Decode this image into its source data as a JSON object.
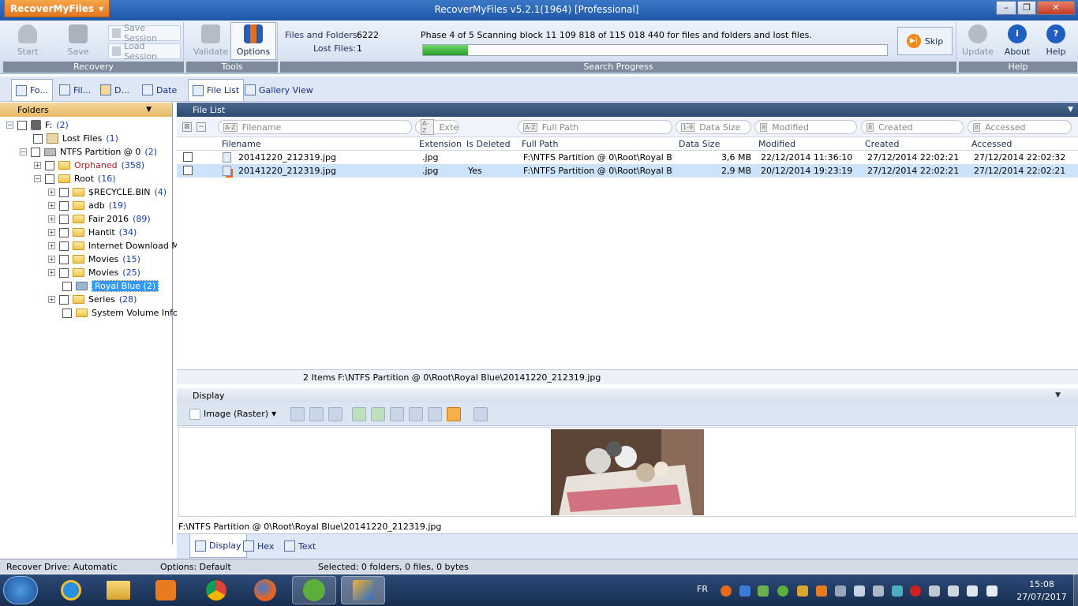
{
  "app": {
    "menu_button": "RecoverMyFiles",
    "window_title": "RecoverMyFiles v5.2.1(1964) [Professional]"
  },
  "ribbon": {
    "recovery": {
      "label": "Recovery",
      "start": "Start",
      "save": "Save",
      "save_session": "Save Session",
      "load_session": "Load Session"
    },
    "tools": {
      "label": "Tools",
      "validate": "Validate",
      "options": "Options"
    },
    "progress": {
      "label": "Search Progress",
      "files_folders_label": "Files and Folders:",
      "files_folders_value": "6222",
      "lost_files_label": "Lost Files:",
      "lost_files_value": "1",
      "phase_text": "Phase 4 of 5  Scanning block 11 109 818 of 115 018 440 for files and folders and lost files.",
      "fraction": 0.0966,
      "skip": "Skip"
    },
    "help": {
      "label": "Help",
      "update": "Update",
      "about": "About",
      "help": "Help"
    }
  },
  "tabs": {
    "left": [
      "Fo...",
      "Fil...",
      "D...",
      "Date"
    ],
    "right": [
      "File List",
      "Gallery View"
    ]
  },
  "folders": {
    "title": "Folders",
    "root_label": "F:",
    "root_count": "(2)",
    "lost_label": "Lost Files",
    "lost_count": "(1)",
    "ntfs_label": "NTFS Partition @ 0",
    "ntfs_count": "(2)",
    "orphaned_label": "Orphaned",
    "orphaned_count": "(358)",
    "root2_label": "Root",
    "root2_count": "(16)",
    "items": [
      {
        "label": "$RECYCLE.BIN",
        "count": "(4)"
      },
      {
        "label": "adb",
        "count": "(19)"
      },
      {
        "label": "Fair 2016",
        "count": "(89)"
      },
      {
        "label": "Hantit",
        "count": "(34)"
      },
      {
        "label": "Internet Download M",
        "count": ""
      },
      {
        "label": "Movies",
        "count": "(15)"
      },
      {
        "label": "Movies",
        "count": "(25)"
      },
      {
        "label": "Royal Blue",
        "count": "(2)"
      },
      {
        "label": "Series",
        "count": "(28)"
      },
      {
        "label": "System Volume Infor",
        "count": ""
      }
    ]
  },
  "filelist": {
    "title": "File List",
    "filters": {
      "filename": "Filename",
      "ext": "Exte",
      "path": "Full Path",
      "size": "Data Size",
      "modified": "Modified",
      "created": "Created",
      "accessed": "Accessed"
    },
    "columns": {
      "filename": "Filename",
      "ext": "Extension",
      "deleted": "Is Deleted",
      "path": "Full Path",
      "size": "Data Size",
      "modified": "Modified",
      "created": "Created",
      "accessed": "Accessed"
    },
    "rows": [
      {
        "filename": "20141220_212319.jpg",
        "ext": ".jpg",
        "deleted": "",
        "path": "F:\\NTFS Partition @ 0\\Root\\Royal Bl...",
        "size": "3,6 MB",
        "modified": "22/12/2014 11:36:10",
        "created": "27/12/2014 22:02:21",
        "accessed": "27/12/2014 22:02:32"
      },
      {
        "filename": "20141220_212319.jpg",
        "ext": ".jpg",
        "deleted": "Yes",
        "path": "F:\\NTFS Partition @ 0\\Root\\Royal Bl...",
        "size": "2,9 MB",
        "modified": "20/12/2014 19:23:19",
        "created": "27/12/2014 22:02:21",
        "accessed": "27/12/2014 22:02:21"
      }
    ],
    "status_count": "2 Items",
    "status_path": "F:\\NTFS Partition @ 0\\Root\\Royal Blue\\20141220_212319.jpg"
  },
  "display": {
    "title": "Display",
    "view_mode": "Image (Raster)",
    "path": "F:\\NTFS Partition @ 0\\Root\\Royal Blue\\20141220_212319.jpg",
    "tabs": [
      "Display",
      "Hex",
      "Text"
    ]
  },
  "statusbar": {
    "drive": "Recover Drive: Automatic",
    "options": "Options: Default",
    "selected": "Selected: 0 folders, 0 files, 0 bytes"
  },
  "taskbar": {
    "lang": "FR",
    "time": "15:08",
    "date": "27/07/2017"
  }
}
